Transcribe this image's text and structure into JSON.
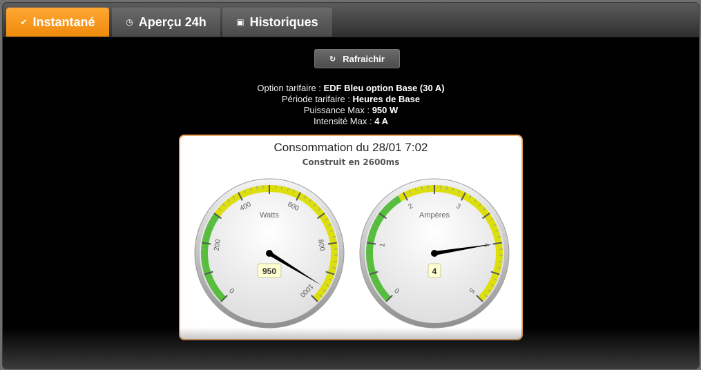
{
  "tabs": [
    {
      "label": "Instantané",
      "icon": "check-icon",
      "active": true
    },
    {
      "label": "Aperçu 24h",
      "icon": "clock-icon",
      "active": false
    },
    {
      "label": "Historiques",
      "icon": "calendar-icon",
      "active": false
    }
  ],
  "refresh_button": {
    "label": "Rafraichir",
    "icon": "refresh-icon"
  },
  "info": {
    "option_label": "Option tarifaire : ",
    "option_value": "EDF Bleu option Base (30 A)",
    "period_label": "Période tarifaire : ",
    "period_value": "Heures de Base",
    "power_label": "Puissance Max : ",
    "power_value": "950 W",
    "current_label": "Intensité Max : ",
    "current_value": "4 A"
  },
  "chart": {
    "title": "Consommation du 28/01 7:02",
    "subtitle": "Construit en 2600ms"
  },
  "colors": {
    "accent": "#f7901e",
    "green_band": "#55bf3b",
    "yellow_band": "#dddf0d",
    "panel_border": "#f0a55e"
  },
  "chart_data": [
    {
      "type": "gauge",
      "title": "Watts",
      "min": 0,
      "max": 1000,
      "tick_labels": [
        "0",
        "200",
        "400",
        "600",
        "800",
        "1000"
      ],
      "bands": [
        {
          "from": 0,
          "to": 300,
          "color": "#55bf3b"
        },
        {
          "from": 300,
          "to": 1000,
          "color": "#dddf0d"
        }
      ],
      "value": 950,
      "value_label": "950"
    },
    {
      "type": "gauge",
      "title": "Ampères",
      "min": 0,
      "max": 5,
      "tick_labels": [
        "0",
        "1",
        "2",
        "3",
        "4",
        "5"
      ],
      "bands": [
        {
          "from": 0,
          "to": 1.9,
          "color": "#55bf3b"
        },
        {
          "from": 1.9,
          "to": 5,
          "color": "#dddf0d"
        }
      ],
      "value": 4,
      "value_label": "4"
    }
  ]
}
